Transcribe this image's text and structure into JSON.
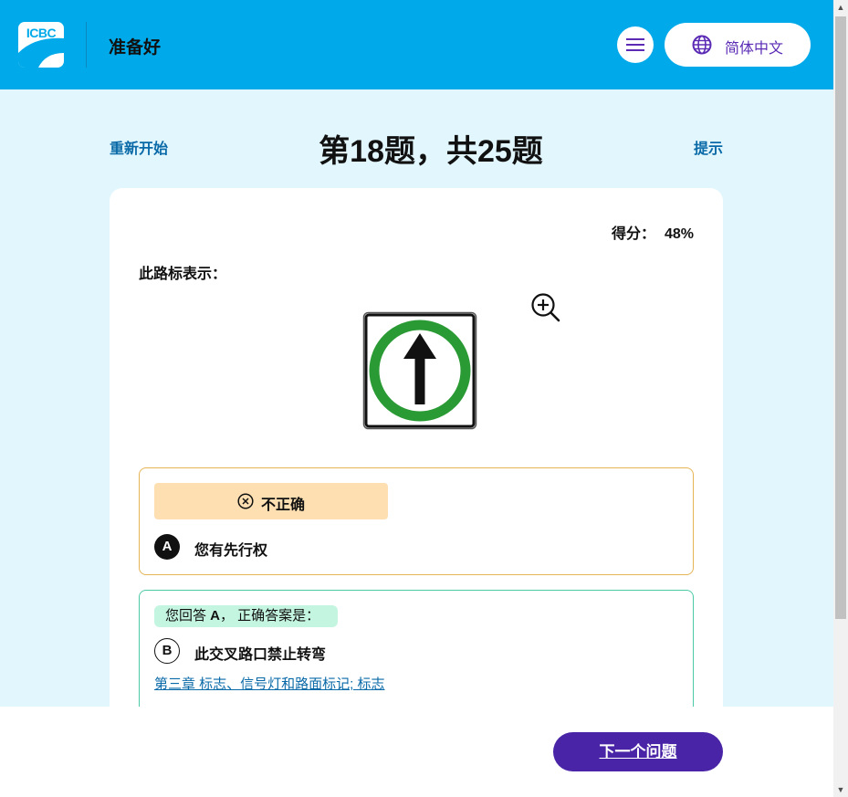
{
  "header": {
    "logo_text": "ICBC",
    "title": "准备好",
    "language": "简体中文"
  },
  "quiz": {
    "restart_label": "重新开始",
    "question_count": "第18题，共25题",
    "hint_label": "提示",
    "score_label": "得分：",
    "score_value": "48%",
    "prompt": "此路标表示：",
    "result_label": "不正确",
    "selected_option": {
      "letter": "A",
      "text": "您有先行权"
    },
    "answer_note_prefix": "您回答 ",
    "answer_note_letter": "A",
    "answer_note_suffix": "， 正确答案是：",
    "correct_option": {
      "letter": "B",
      "text": "此交叉路口禁止转弯"
    },
    "chapter_link": "第三章 标志、信号灯和路面标记; 标志"
  },
  "footer": {
    "next_label": "下一个问题"
  },
  "colors": {
    "header_bg": "#00aaea",
    "page_bg": "#e2f6fd",
    "accent_purple": "#4a24a6",
    "incorrect_bg": "#fddfb2",
    "correct_bg": "#c4f5e1",
    "sign_green": "#2a9a34"
  },
  "icons": {
    "menu": "hamburger-icon",
    "language": "globe-icon",
    "zoom": "zoom-in-icon",
    "incorrect": "circle-x-icon"
  }
}
